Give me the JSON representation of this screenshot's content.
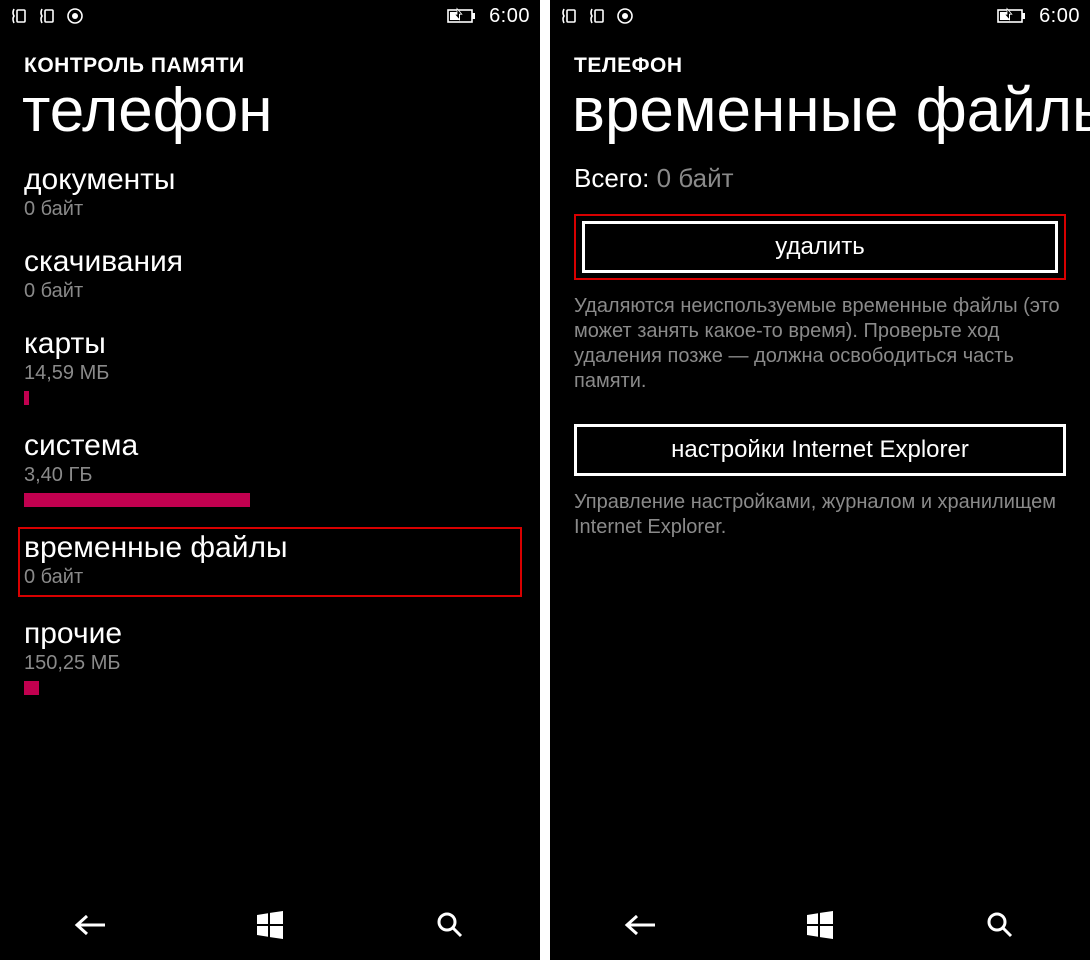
{
  "status": {
    "time": "6:00"
  },
  "left": {
    "app_name": "КОНТРОЛЬ ПАМЯТИ",
    "page_title": "телефон",
    "categories": [
      {
        "title": "документы",
        "size": "0 байт",
        "bar_pct": 0,
        "highlight": false
      },
      {
        "title": "скачивания",
        "size": "0 байт",
        "bar_pct": 0,
        "highlight": false
      },
      {
        "title": "карты",
        "size": "14,59 МБ",
        "bar_pct": 1,
        "highlight": false
      },
      {
        "title": "система",
        "size": "3,40 ГБ",
        "bar_pct": 46,
        "highlight": false
      },
      {
        "title": "временные файлы",
        "size": "0 байт",
        "bar_pct": 0,
        "highlight": true
      },
      {
        "title": "прочие",
        "size": "150,25 МБ",
        "bar_pct": 3,
        "highlight": false
      }
    ]
  },
  "right": {
    "app_name": "ТЕЛЕФОН",
    "page_title": "временные файлы",
    "total_label": "Всего:",
    "total_value": "0 байт",
    "delete_label": "удалить",
    "delete_desc": "Удаляются неиспользуемые временные файлы (это может занять какое-то время). Проверьте ход удаления позже — должна освободиться часть памяти.",
    "ie_label": "настройки Internet Explorer",
    "ie_desc": "Управление настройками, журналом и хранилищем Internet Explorer."
  }
}
